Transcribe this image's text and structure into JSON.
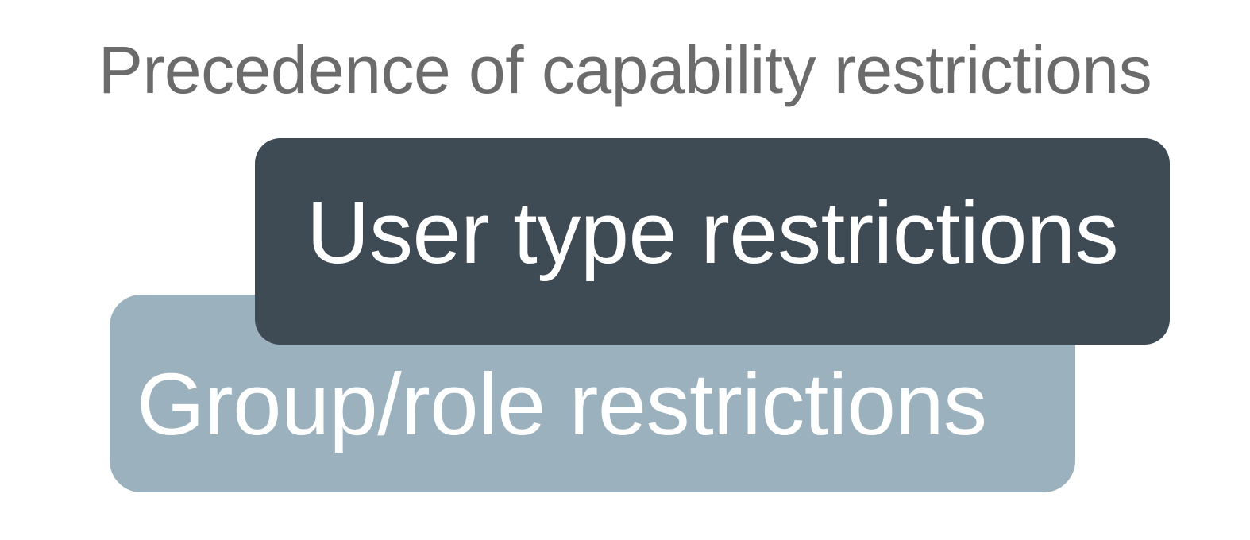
{
  "diagram": {
    "title": "Precedence of capability restrictions",
    "layers": [
      {
        "label": "User type restrictions",
        "color": "#3e4a54"
      },
      {
        "label": "Group/role restrictions",
        "color": "#9bb1bd"
      }
    ],
    "title_color": "#6b6b6b",
    "text_color": "#ffffff"
  }
}
